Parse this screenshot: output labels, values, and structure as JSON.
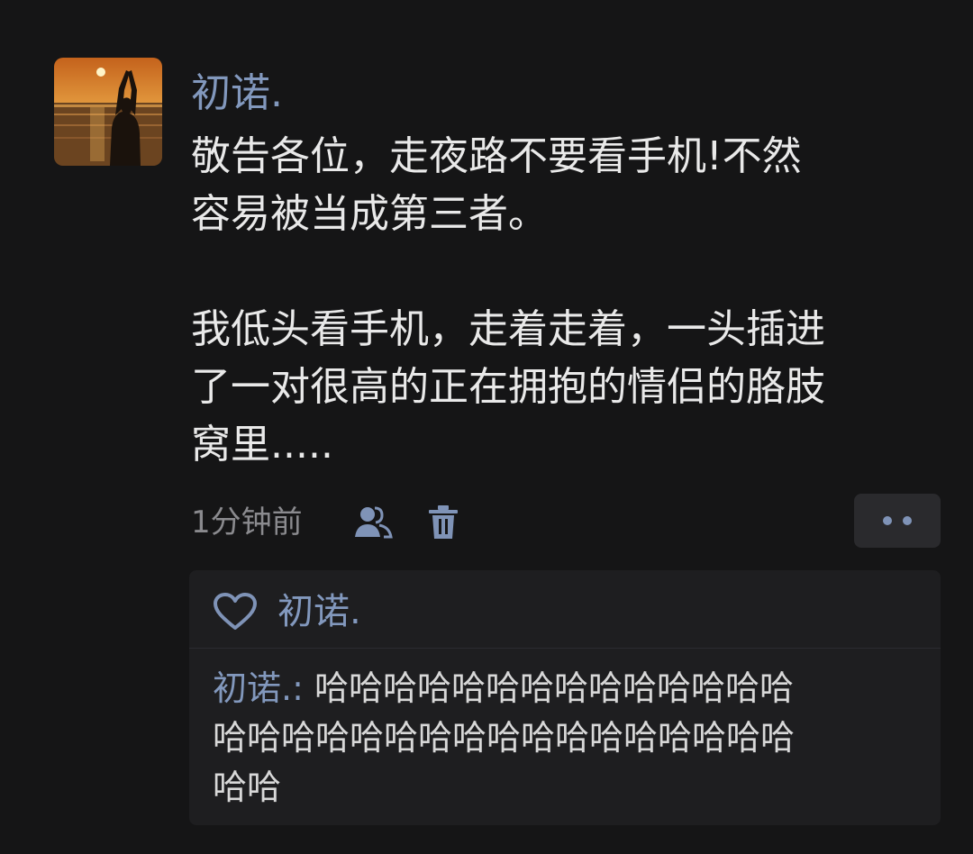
{
  "post": {
    "username": "初诺.",
    "text_lines_para1": [
      "敬告各位，走夜路不要看手机!不然",
      "容易被当成第三者。"
    ],
    "text_lines_para2": [
      "我低头看手机，走着走着，一头插进",
      "了一对很高的正在拥抱的情侣的胳肢",
      "窝里....."
    ],
    "timestamp": "1分钟前",
    "icons": {
      "avatar": "sunset-silhouette-avatar",
      "visibility": "friends-visibility-icon",
      "delete": "trash-icon",
      "more": "more-dots-icon",
      "like": "heart-icon"
    }
  },
  "likes": {
    "users": "初诺."
  },
  "comments": [
    {
      "author": "初诺.",
      "separator": ":",
      "text_lines": [
        " 哈哈哈哈哈哈哈哈哈哈哈哈哈哈",
        "哈哈哈哈哈哈哈哈哈哈哈哈哈哈哈哈哈",
        "哈哈"
      ]
    }
  ],
  "colors": {
    "background": "#151516",
    "link_blue": "#8298bd",
    "body_text": "#e9e9e9",
    "meta_gray": "#8a8a8e",
    "reply_box": "#1e1e20"
  }
}
